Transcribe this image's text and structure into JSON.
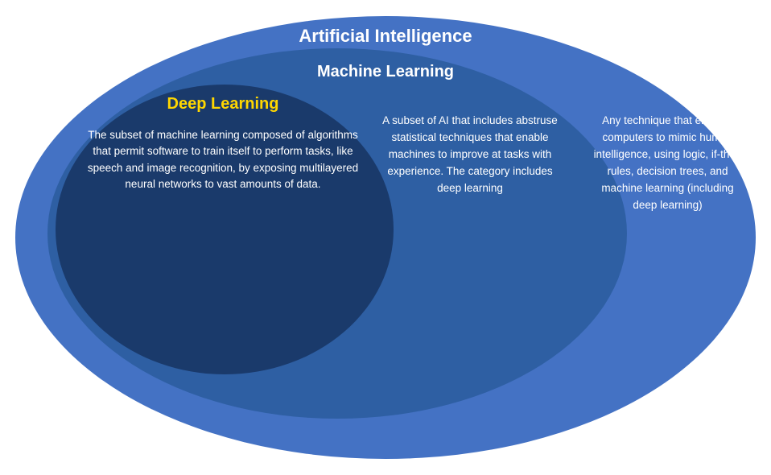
{
  "diagram": {
    "ai_title": "Artificial Intelligence",
    "ml_title": "Machine Learning",
    "dl_title": "Deep Learning",
    "dl_description": "The subset of machine learning composed of algorithms that permit software to train itself to perform tasks, like speech and image recognition, by exposing multilayered neural networks to vast amounts of data.",
    "ml_description": "A subset of AI that includes abstruse statistical techniques that enable machines to improve at tasks with experience. The category includes deep learning",
    "ai_description": "Any technique that enables computers to mimic human intelligence, using logic, if-then rules, decision trees, and machine learning (including deep learning)"
  }
}
